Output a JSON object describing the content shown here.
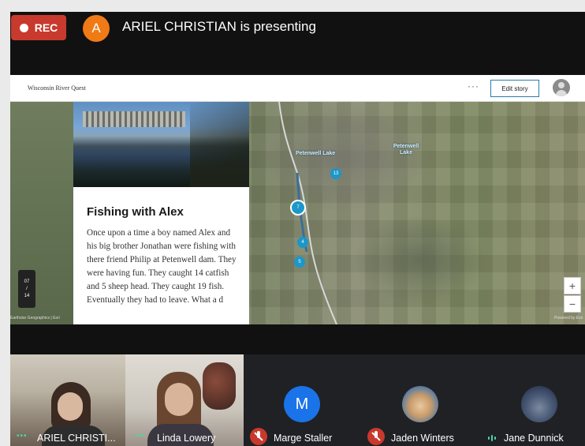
{
  "recording": {
    "label": "REC"
  },
  "presenter": {
    "initial": "A",
    "text": "ARIEL CHRISTIAN is presenting"
  },
  "story": {
    "title": "Wisconsin River Quest",
    "more": "···",
    "edit_label": "Edit story",
    "card_title": "Fishing with Alex",
    "card_text": "Once upon a time a boy named Alex and his big brother Jonathan were fishing with there friend Philip at Petenwell dam. They were having fun. They caught 14 catfish and 5 sheep head. They caught 19 fish. Eventually they had to leave. What a d",
    "page_current": "07",
    "page_sep": "/",
    "page_total": "14"
  },
  "map": {
    "lake_label_1": "Petenwell Lake",
    "lake_label_2": "Petenwell Lake",
    "markers": [
      "13",
      "7",
      "4",
      "5"
    ],
    "zoom_in": "+",
    "zoom_out": "−",
    "attribution_left": "Earthstar Geographics | Esri",
    "attribution_right": "Powered by Esri"
  },
  "participants": [
    {
      "name": "ARIEL CHRISTI...",
      "status": "camera"
    },
    {
      "name": "Linda Lowery",
      "status": "camera"
    },
    {
      "name": "Marge Staller",
      "initial": "M",
      "status": "muted"
    },
    {
      "name": "Jaden Winters",
      "status": "muted"
    },
    {
      "name": "Jane Dunnick",
      "status": "speaking"
    }
  ],
  "colors": {
    "rec": "#c83a2d",
    "presenter_avatar": "#f07a16",
    "marge_avatar": "#1a73e8",
    "edit_border": "#2a7ba6",
    "marker": "#1b97c9"
  }
}
